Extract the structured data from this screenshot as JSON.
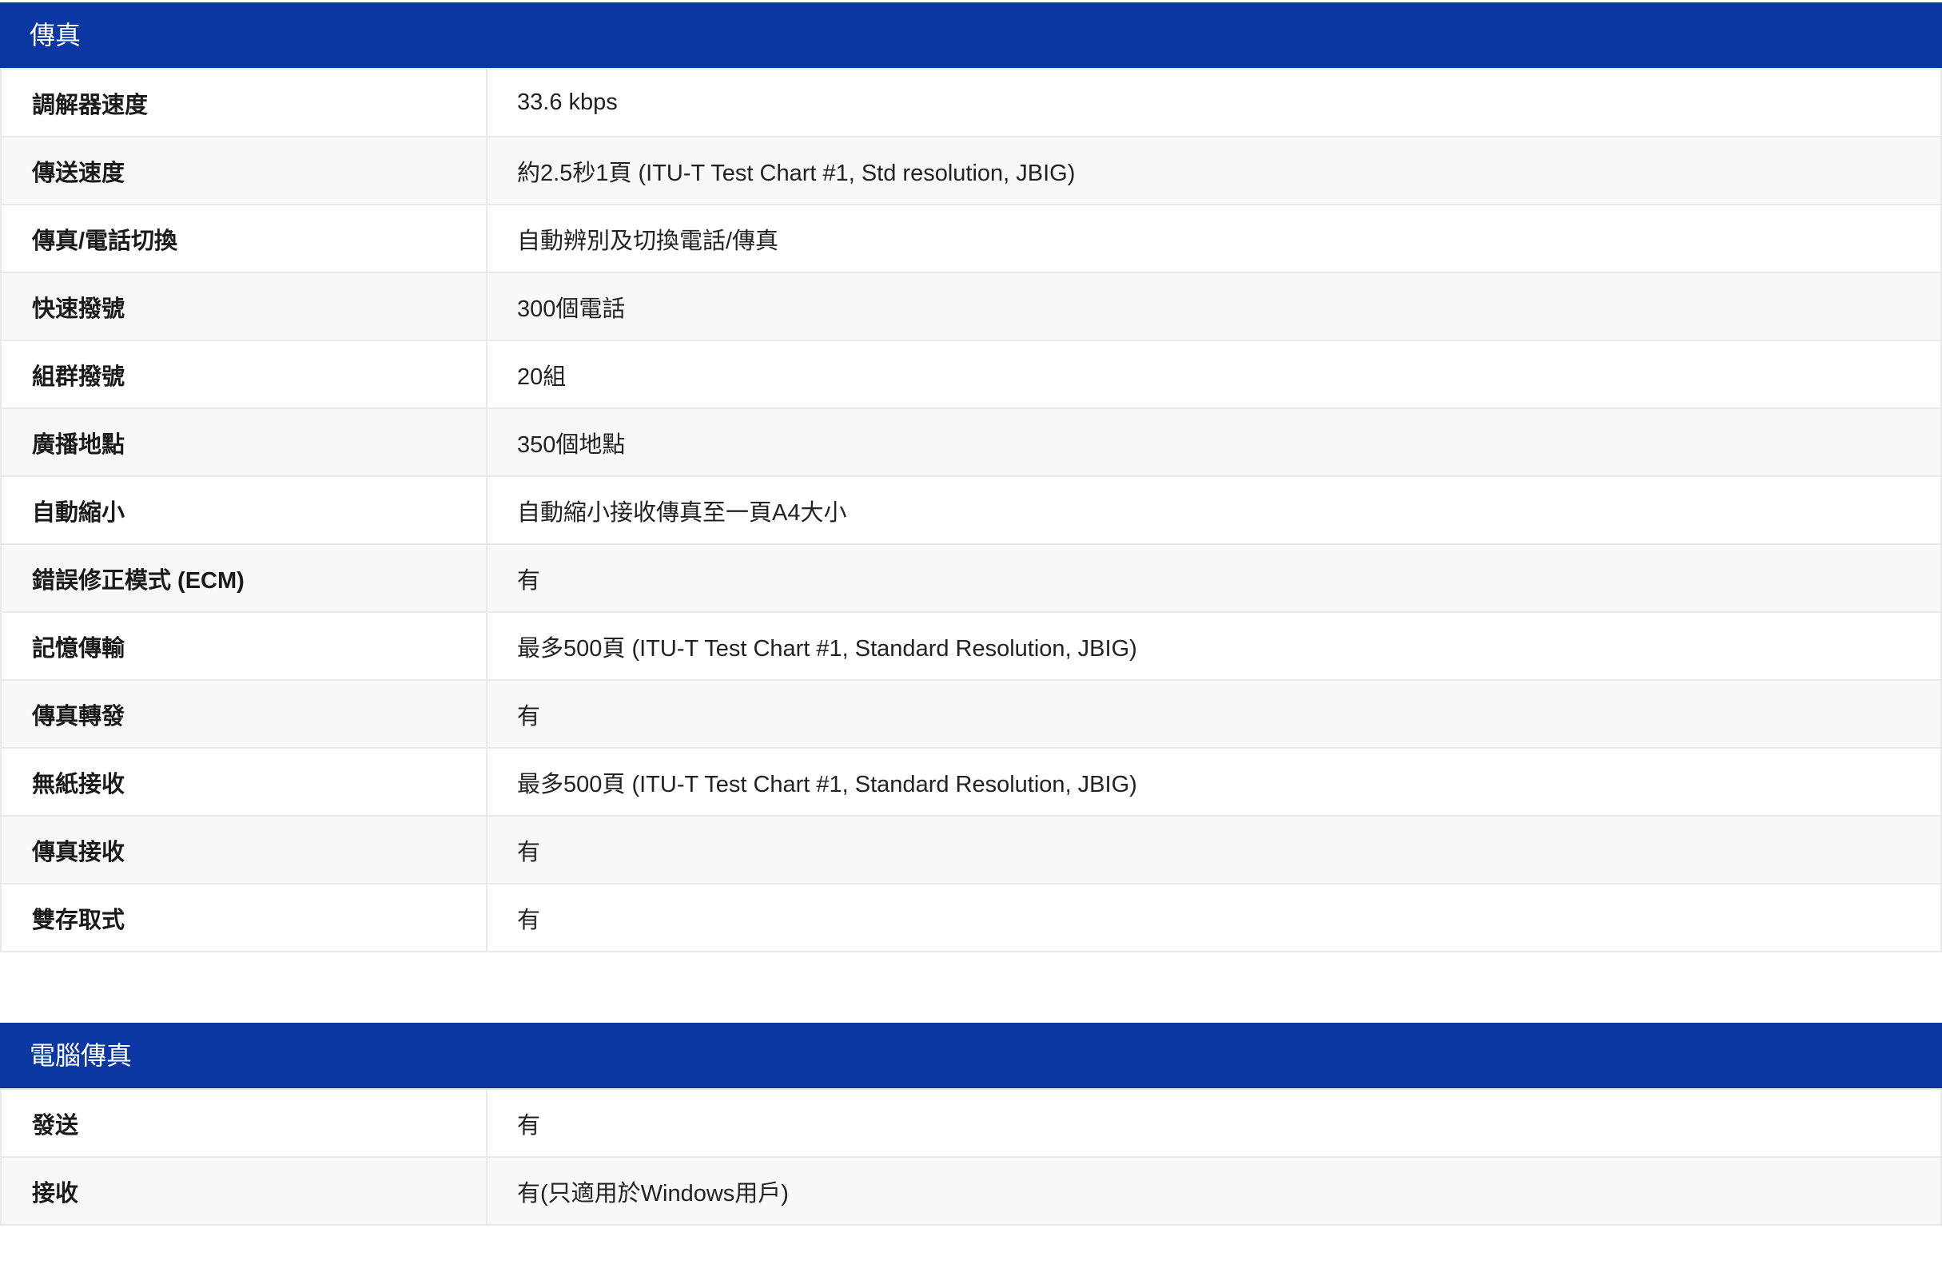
{
  "fax": {
    "title": "傳真",
    "rows": [
      {
        "label": "調解器速度",
        "value": "33.6 kbps"
      },
      {
        "label": "傳送速度",
        "value": "約2.5秒1頁 (ITU-T Test Chart #1, Std resolution, JBIG)"
      },
      {
        "label": "傳真/電話切換",
        "value": "自動辨別及切換電話/傳真"
      },
      {
        "label": "快速撥號",
        "value": "300個電話"
      },
      {
        "label": "組群撥號",
        "value": "20組"
      },
      {
        "label": "廣播地點",
        "value": "350個地點"
      },
      {
        "label": "自動縮小",
        "value": "自動縮小接收傳真至一頁A4大小"
      },
      {
        "label": "錯誤修正模式 (ECM)",
        "value": "有"
      },
      {
        "label": "記憶傳輸",
        "value": "最多500頁 (ITU-T Test Chart #1, Standard Resolution, JBIG)"
      },
      {
        "label": "傳真轉發",
        "value": "有"
      },
      {
        "label": "無紙接收",
        "value": "最多500頁 (ITU-T Test Chart #1, Standard Resolution, JBIG)"
      },
      {
        "label": "傳真接收",
        "value": "有"
      },
      {
        "label": "雙存取式",
        "value": "有"
      }
    ]
  },
  "pc_fax": {
    "title": "電腦傳真",
    "rows": [
      {
        "label": "發送",
        "value": "有"
      },
      {
        "label": "接收",
        "value": "有(只適用於Windows用戶)"
      }
    ]
  },
  "colors": {
    "header_bg": "#0a37a2",
    "header_text": "#ffffff",
    "row_alt_bg": "#f8f8f8",
    "border": "#e9e9e9"
  }
}
